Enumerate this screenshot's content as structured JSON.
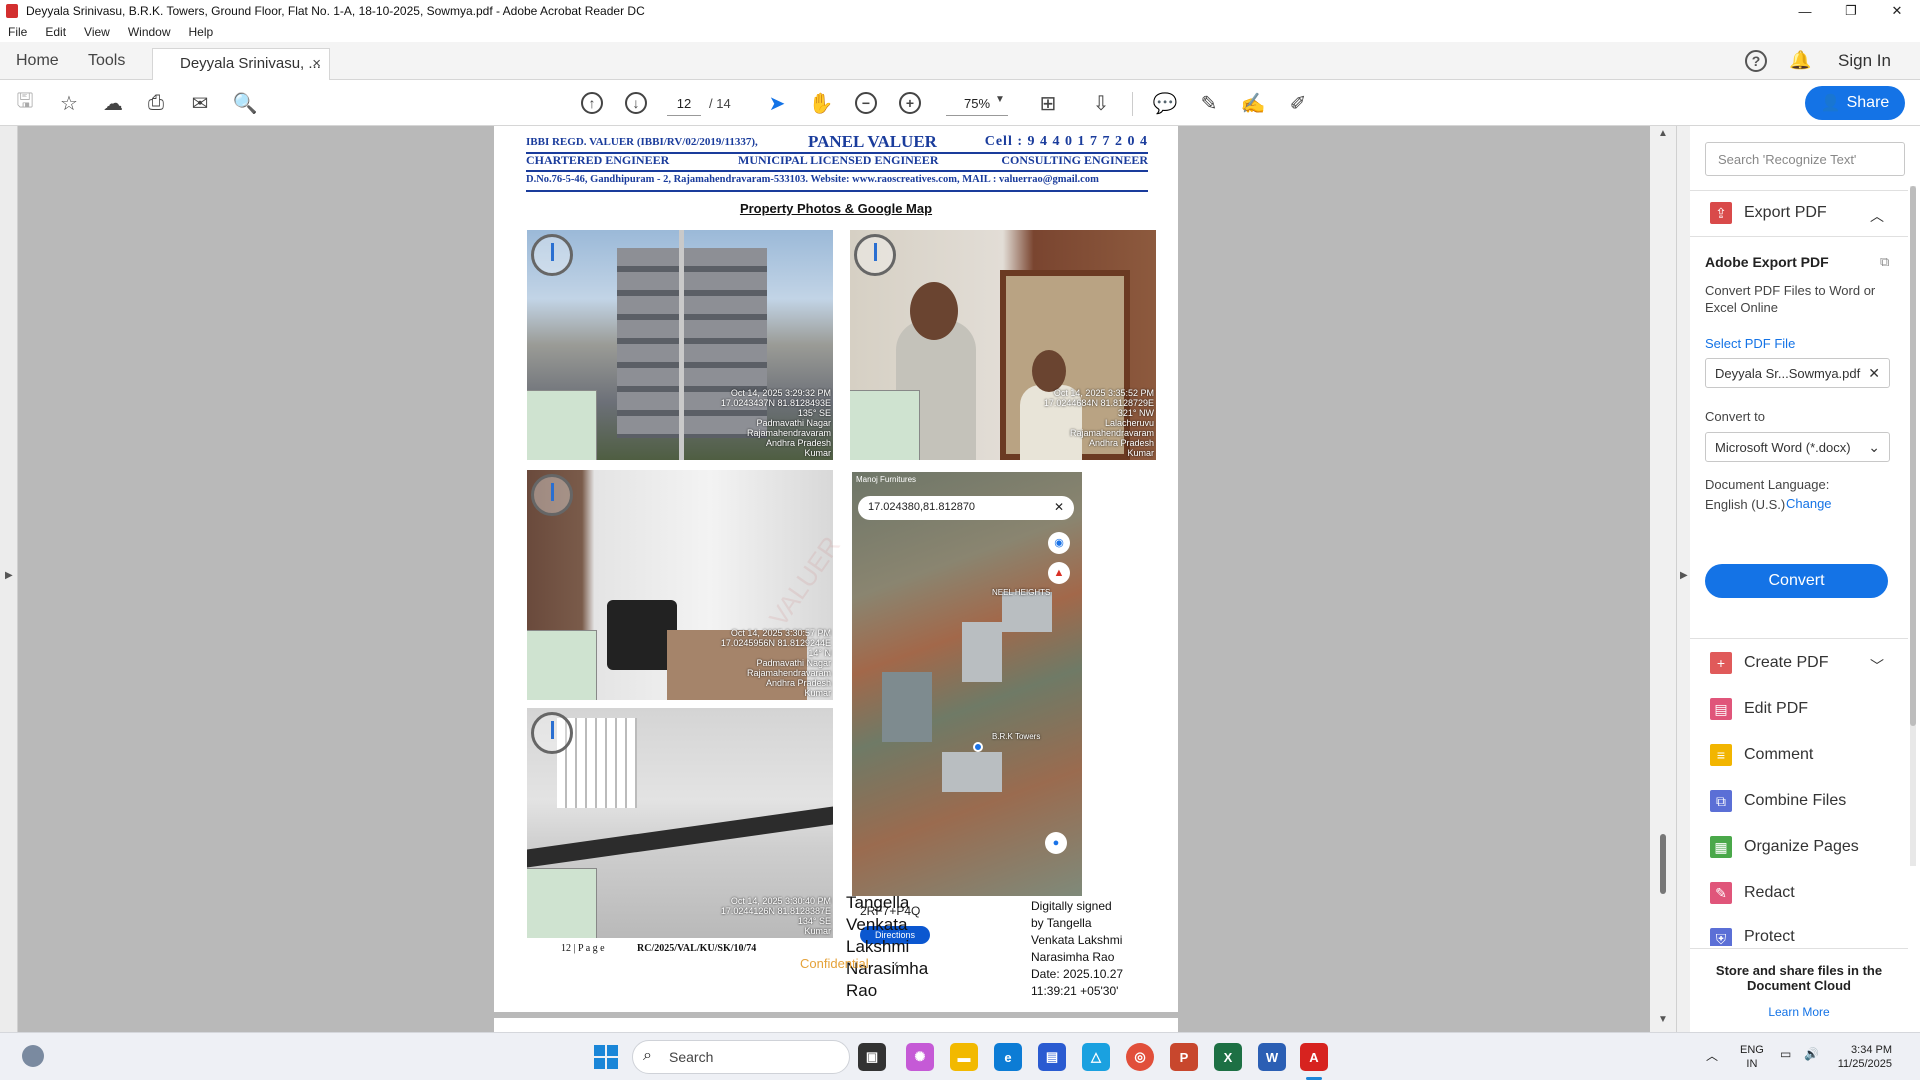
{
  "window": {
    "title": "Deyyala Srinivasu, B.R.K. Towers, Ground Floor, Flat No. 1-A, 18-10-2025, Sowmya.pdf - Adobe Acrobat Reader DC",
    "minimize": "—",
    "maximize": "❐",
    "close": "✕"
  },
  "menu": [
    "File",
    "Edit",
    "View",
    "Window",
    "Help"
  ],
  "tabs": {
    "home": "Home",
    "tools": "Tools",
    "doc": "Deyyala Srinivasu, ...",
    "close": "×",
    "help": "?",
    "signin": "Sign In"
  },
  "toolbar": {
    "page_current": "12",
    "page_total": "/ 14",
    "zoom": "75%",
    "share": "Share"
  },
  "document": {
    "header_regd": "IBBI REGD. VALUER (IBBI/RV/02/2019/11337),",
    "header_panel": "PANEL VALUER",
    "header_cell": "Cell : 9 4 4 0 1 7 7 2 0 4",
    "header_chartered": "CHARTERED ENGINEER",
    "header_municipal": "MUNICIPAL LICENSED ENGINEER",
    "header_consulting": "CONSULTING  ENGINEER",
    "header_address": "D.No.76-5-46, Gandhipuram - 2, Rajamahendravaram-533103. Website: www.raoscreatives.com, MAIL : valuerrao@gmail.com",
    "title": "Property Photos & Google Map",
    "photo1_stamp": [
      "Oct 14, 2025 3:29:32 PM",
      "17.0243437N 81.8128493E",
      "135° SE",
      "Padmavathi Nagar",
      "Rajamahendravaram",
      "Andhra Pradesh",
      "Kumar"
    ],
    "photo2_stamp": [
      "Oct 14, 2025 3:35:52 PM",
      "17.0244684N 81.8128729E",
      "321° NW",
      "Lalacheruvu",
      "Rajamahendravaram",
      "Andhra Pradesh",
      "Kumar"
    ],
    "photo3_stamp": [
      "Oct 14, 2025 3:30:57 PM",
      "17.0245956N 81.8129244E",
      "14° N",
      "Padmavathi Nagar",
      "Rajamahendravaram",
      "Andhra Pradesh",
      "Kumar"
    ],
    "photo4_stamp": [
      "Oct 14, 2025 3:30:40 PM",
      "17.0244126N 81.8128387E",
      "134° SE",
      "Kumar"
    ],
    "map_top": "Manoj Furnitures",
    "map_coords": "17.024380,81.812870",
    "map_label_neel": "NEEL HEIGHTS",
    "map_label_brk": "B.R.K Towers",
    "map_plus_code": "2RF7+P4Q",
    "map_directions": "Directions",
    "signer_name": [
      "Tangella",
      "Venkata",
      "Lakshmi",
      "Narasimha",
      "Rao"
    ],
    "sig_details": [
      "Digitally signed",
      "by Tangella",
      "Venkata Lakshmi",
      "Narasimha Rao",
      "Date: 2025.10.27",
      "11:39:21 +05'30'"
    ],
    "footer_page": "12 | P a g e",
    "footer_ref": "RC/2025/VAL/KU/SK/10/74",
    "confidential": "Confidential"
  },
  "right_panel": {
    "search_placeholder": "Search 'Recognize Text'",
    "export_pdf": "Export PDF",
    "adobe_export_title": "Adobe Export PDF",
    "adobe_export_desc": "Convert PDF Files to Word or Excel Online",
    "select_file": "Select PDF File",
    "file_name": "Deyyala Sr...Sowmya.pdf",
    "convert_to": "Convert to",
    "format": "Microsoft Word (*.docx)",
    "doc_language": "Document Language:",
    "language": "English (U.S.)",
    "change": "Change",
    "convert": "Convert",
    "tools": [
      "Create PDF",
      "Edit PDF",
      "Comment",
      "Combine Files",
      "Organize Pages",
      "Redact",
      "Protect"
    ],
    "cloud_text": "Store and share files in the Document Cloud",
    "learn_more": "Learn More",
    "colors": {
      "accent": "#1473e6"
    }
  },
  "taskbar": {
    "search": "Search",
    "lang1": "ENG",
    "lang2": "IN",
    "time": "3:34 PM",
    "date": "11/25/2025"
  }
}
